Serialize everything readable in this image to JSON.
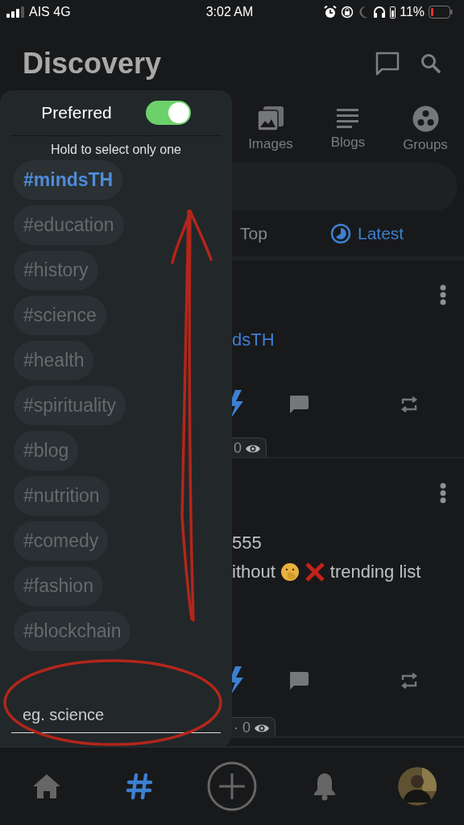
{
  "status_bar": {
    "carrier": "AIS 4G",
    "time": "3:02 AM",
    "battery": "11%"
  },
  "header": {
    "title": "Discovery"
  },
  "tabs": [
    {
      "label": "Images",
      "kind": "images",
      "selected": false
    },
    {
      "label": "Blogs",
      "kind": "blogs",
      "selected": false
    },
    {
      "label": "Groups",
      "kind": "groups",
      "selected": false
    }
  ],
  "filters": [
    {
      "label": "Top",
      "kind": "top",
      "selected": false
    },
    {
      "label": "Latest",
      "kind": "latest",
      "selected": true
    }
  ],
  "posts": [
    {
      "lines": [
        {
          "kind": "tag",
          "text": "dsTH"
        }
      ],
      "views": "0"
    },
    {
      "lines": [
        {
          "kind": "plain",
          "text": "555"
        },
        {
          "kind": "emoji",
          "before": "ithout",
          "after": "trending list"
        }
      ],
      "views": "· 0"
    }
  ],
  "tag_panel": {
    "title": "Preferred",
    "preferred_on": true,
    "hint": "Hold to select only one",
    "tags": [
      {
        "label": "#mindsTH",
        "selected": true
      },
      {
        "label": "#education",
        "selected": false
      },
      {
        "label": "#history",
        "selected": false
      },
      {
        "label": "#science",
        "selected": false
      },
      {
        "label": "#health",
        "selected": false
      },
      {
        "label": "#spirituality",
        "selected": false
      },
      {
        "label": "#blog",
        "selected": false
      },
      {
        "label": "#nutrition",
        "selected": false
      },
      {
        "label": "#comedy",
        "selected": false
      },
      {
        "label": "#fashion",
        "selected": false
      },
      {
        "label": "#blockchain",
        "selected": false
      }
    ],
    "input": {
      "placeholder": "eg. science"
    }
  },
  "bottom_nav": [
    {
      "kind": "home",
      "selected": false
    },
    {
      "kind": "discovery",
      "selected": true
    },
    {
      "kind": "compose",
      "selected": false
    },
    {
      "kind": "notifications",
      "selected": false
    },
    {
      "kind": "profile",
      "selected": false
    }
  ]
}
